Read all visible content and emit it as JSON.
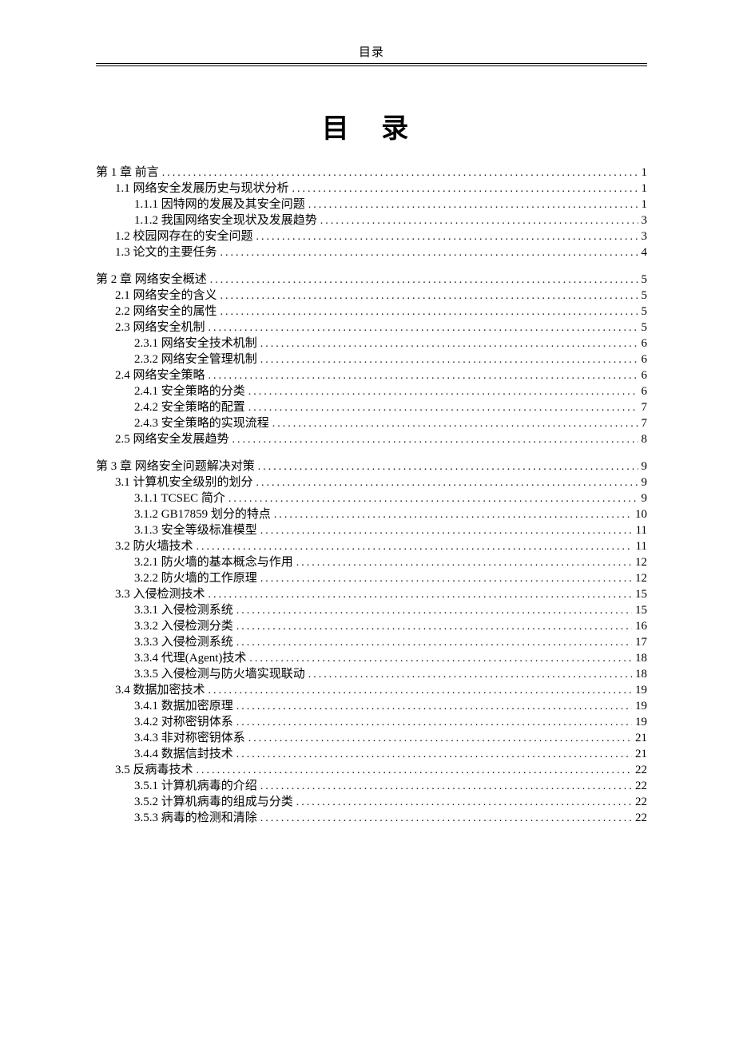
{
  "running_head": "目录",
  "title": "目 录",
  "toc": [
    {
      "level": 0,
      "text": "第 1 章 前言",
      "page": "1",
      "gap": false
    },
    {
      "level": 1,
      "text": "1.1 网络安全发展历史与现状分析",
      "page": "1",
      "gap": false
    },
    {
      "level": 2,
      "text": "1.1.1 因特网的发展及其安全问题",
      "page": "1",
      "gap": false
    },
    {
      "level": 2,
      "text": "1.1.2 我国网络安全现状及发展趋势",
      "page": "3",
      "gap": false
    },
    {
      "level": 1,
      "text": "1.2 校园网存在的安全问题",
      "page": "3",
      "gap": false
    },
    {
      "level": 1,
      "text": "1.3 论文的主要任务",
      "page": "4",
      "gap": false
    },
    {
      "level": 0,
      "text": "第 2 章 网络安全概述",
      "page": "5",
      "gap": true
    },
    {
      "level": 1,
      "text": "2.1 网络安全的含义",
      "page": "5",
      "gap": false
    },
    {
      "level": 1,
      "text": "2.2 网络安全的属性",
      "page": "5",
      "gap": false
    },
    {
      "level": 1,
      "text": "2.3 网络安全机制",
      "page": "5",
      "gap": false
    },
    {
      "level": 2,
      "text": "2.3.1 网络安全技术机制",
      "page": "6",
      "gap": false
    },
    {
      "level": 2,
      "text": "2.3.2 网络安全管理机制",
      "page": "6",
      "gap": false
    },
    {
      "level": 1,
      "text": "2.4 网络安全策略",
      "page": "6",
      "gap": false
    },
    {
      "level": 2,
      "text": "2.4.1 安全策略的分类",
      "page": "6",
      "gap": false
    },
    {
      "level": 2,
      "text": "2.4.2 安全策略的配置",
      "page": "7",
      "gap": false
    },
    {
      "level": 2,
      "text": "2.4.3 安全策略的实现流程",
      "page": "7",
      "gap": false
    },
    {
      "level": 1,
      "text": "2.5 网络安全发展趋势",
      "page": "8",
      "gap": false
    },
    {
      "level": 0,
      "text": "第 3 章 网络安全问题解决对策",
      "page": "9",
      "gap": true
    },
    {
      "level": 1,
      "text": "3.1 计算机安全级别的划分",
      "page": "9",
      "gap": false
    },
    {
      "level": 2,
      "text": "3.1.1 TCSEC 简介",
      "page": "9",
      "gap": false
    },
    {
      "level": 2,
      "text": "3.1.2 GB17859 划分的特点",
      "page": "10",
      "gap": false
    },
    {
      "level": 2,
      "text": "3.1.3 安全等级标准模型",
      "page": "11",
      "gap": false
    },
    {
      "level": 1,
      "text": "3.2 防火墙技术",
      "page": "11",
      "gap": false
    },
    {
      "level": 2,
      "text": "3.2.1 防火墙的基本概念与作用",
      "page": "12",
      "gap": false
    },
    {
      "level": 2,
      "text": "3.2.2 防火墙的工作原理",
      "page": "12",
      "gap": false
    },
    {
      "level": 1,
      "text": "3.3 入侵检测技术",
      "page": "15",
      "gap": false
    },
    {
      "level": 2,
      "text": "3.3.1 入侵检测系统",
      "page": "15",
      "gap": false
    },
    {
      "level": 2,
      "text": "3.3.2 入侵检测分类",
      "page": "16",
      "gap": false
    },
    {
      "level": 2,
      "text": "3.3.3 入侵检测系统",
      "page": "17",
      "gap": false
    },
    {
      "level": 2,
      "text": "3.3.4 代理(Agent)技术",
      "page": "18",
      "gap": false
    },
    {
      "level": 2,
      "text": "3.3.5 入侵检测与防火墙实现联动",
      "page": "18",
      "gap": false
    },
    {
      "level": 1,
      "text": "3.4 数据加密技术",
      "page": "19",
      "gap": false
    },
    {
      "level": 2,
      "text": "3.4.1 数据加密原理",
      "page": "19",
      "gap": false
    },
    {
      "level": 2,
      "text": "3.4.2 对称密钥体系",
      "page": "19",
      "gap": false
    },
    {
      "level": 2,
      "text": "3.4.3 非对称密钥体系",
      "page": "21",
      "gap": false
    },
    {
      "level": 2,
      "text": "3.4.4 数据信封技术",
      "page": "21",
      "gap": false
    },
    {
      "level": 1,
      "text": "3.5 反病毒技术",
      "page": "22",
      "gap": false
    },
    {
      "level": 2,
      "text": "3.5.1 计算机病毒的介绍",
      "page": "22",
      "gap": false
    },
    {
      "level": 2,
      "text": "3.5.2 计算机病毒的组成与分类",
      "page": "22",
      "gap": false
    },
    {
      "level": 2,
      "text": "3.5.3 病毒的检测和清除",
      "page": "22",
      "gap": false
    }
  ]
}
